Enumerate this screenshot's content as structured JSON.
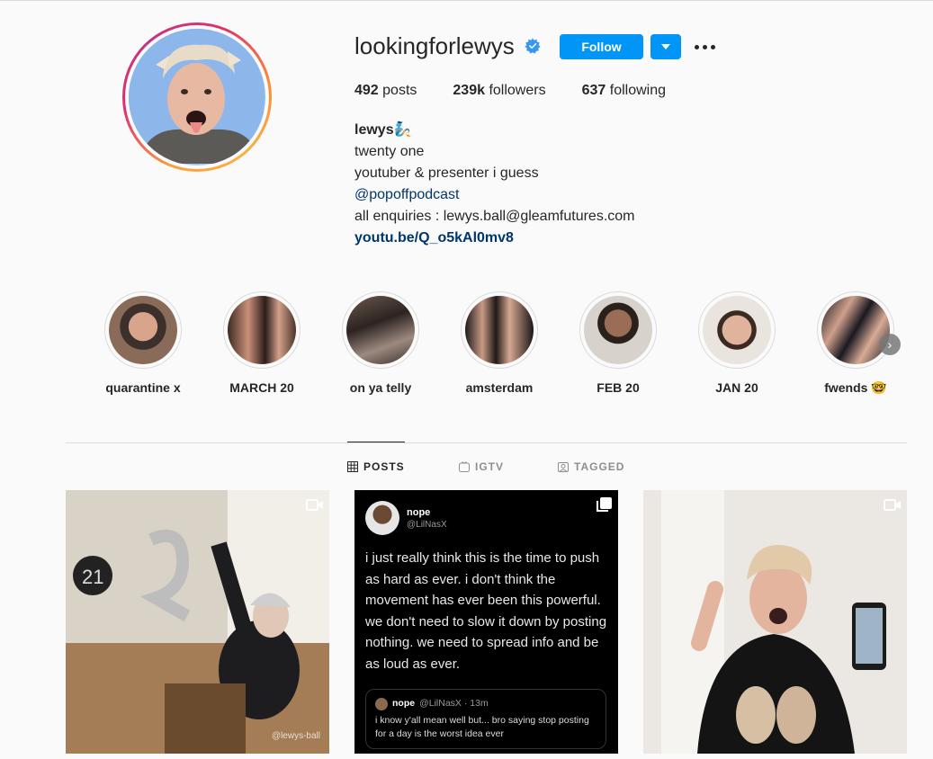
{
  "profile": {
    "username": "lookingforlewys",
    "follow_label": "Follow",
    "stats": {
      "posts_count": "492",
      "posts_label": "posts",
      "followers_count": "239k",
      "followers_label": "followers",
      "following_count": "637",
      "following_label": "following"
    },
    "bio": {
      "name": "lewys🧞",
      "line1": "twenty one",
      "line2": "youtuber & presenter i guess",
      "mention": "@popoffpodcast",
      "line3": "all enquiries : lewys.ball@gleamfutures.com",
      "link": "youtu.be/Q_o5kAl0mv8"
    }
  },
  "highlights": [
    {
      "label": "quarantine x"
    },
    {
      "label": "MARCH 20"
    },
    {
      "label": "on ya telly"
    },
    {
      "label": "amsterdam"
    },
    {
      "label": "FEB 20"
    },
    {
      "label": "JAN 20"
    },
    {
      "label": "fwends 🤓"
    }
  ],
  "tabs": [
    {
      "label": "POSTS",
      "icon": "grid-icon",
      "active": true
    },
    {
      "label": "IGTV",
      "icon": "igtv-icon",
      "active": false
    },
    {
      "label": "TAGGED",
      "icon": "tagged-icon",
      "active": false
    }
  ],
  "posts": {
    "post1": {
      "watermark": "@lewys-ball",
      "icon": "camera-icon"
    },
    "post2": {
      "icon": "carousel-icon",
      "tweet_name": "nope",
      "tweet_handle": "@LilNasX",
      "tweet_body": "i just really think this is the time to push as hard as ever. i don't think the movement has ever been this powerful. we don't need to slow it down by posting nothing. we need to spread info and be as loud as ever.",
      "quote_name": "nope",
      "quote_handle": "@LilNasX · 13m",
      "quote_body": "i know y'all mean well but... bro saying stop posting for a day is the worst idea ever"
    },
    "post3": {
      "icon": "camera-icon"
    }
  },
  "colors": {
    "accent": "#0095f6",
    "link": "#00376b",
    "background": "#fafafa"
  }
}
